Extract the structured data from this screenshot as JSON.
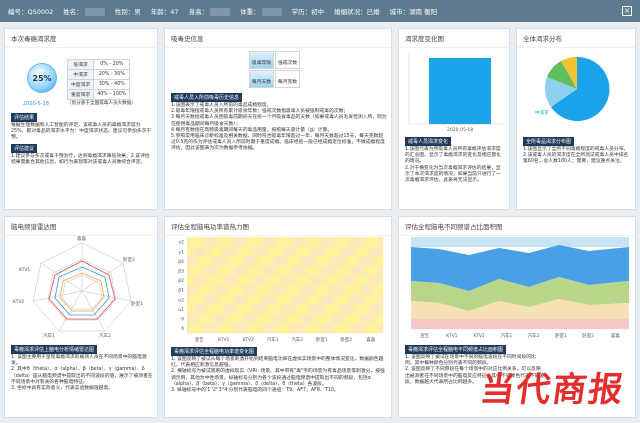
{
  "header": {
    "id_label": "编号：",
    "id_value": "QS0002",
    "name_label": "姓名：",
    "gender_label": "性别：",
    "gender_value": "男",
    "age_label": "年龄：",
    "age_value": "47",
    "height_label": "身高：",
    "weight_label": "体重：",
    "edu_label": "学历：",
    "edu_value": "初中",
    "marital_label": "婚姻状况：",
    "marital_value": "已婚",
    "city_label": "城市：",
    "city_value": "湖南 衡阳",
    "close_glyph": "×",
    "bar_color": "#5d7a8e"
  },
  "craving": {
    "title": "本次毒瘾渴求度",
    "percent": "25%",
    "date": "2020-5-18",
    "levels": [
      {
        "name": "低渴求",
        "range": "0% - 20%"
      },
      {
        "name": "中渴求",
        "range": "20% - 30%"
      },
      {
        "name": "中度渴求",
        "range": "30% - 40%"
      },
      {
        "name": "重度渴求",
        "range": "40% - 100%"
      }
    ],
    "footnote": "（划分基于全国戒毒人员大数据）",
    "result_tag": "评估结果",
    "result_text": "根据生理数据和人工智能的评定，该戒毒人员的毒瘾渴求度为25%，即对毒品的渴求水平为：中度渴求状态。建议可参加多次干预。",
    "advice_tag": "评估建议",
    "advice_text": "1.建议参与多次戒毒干预治疗，达到毒瘾渴求降低效果；2.该评估结果需集合其他信息，如行为表现等对该戒毒人员做综合评定。"
  },
  "history": {
    "title": "吸毒史信息",
    "cells": [
      "吸毒年限",
      "强戒次数",
      "每月天数",
      "每月克数"
    ],
    "tag": "戒毒人员入所前吸毒历史信息",
    "text": "1.该图表示了戒毒人员入所前的毒品成瘾程度。\n2.吸毒年限指戒毒人员所有累计吸食年数；强戒次数指吸毒人员被强制戒毒的次数；\n3.每月天数指戒毒人员回吸毒前期间天在统一个月吸食毒品的天数（如果戒毒人员毛发检测入所，则为在使用毒品期间每月吸食天数）；\n4.每月克数指在高频吸毒期间每天的毒品用量，按照每天吸计量（g）计算。\n5.参照常用临床诊断标准及相关数据，同时符合吸毒年限超过一年，每月天数超过15天，每天克数超过0.5克的作为评估戒毒人员入所前时期于重度成瘾。临床经验一般已经成瘾定位标准，不做成瘾程度评估，因此该图表为次为数据参考依据。"
  },
  "trend": {
    "title": "渴求度变化图",
    "date": "2020-05-18",
    "tag": "戒毒人员渴求变化",
    "text": "1.该图代表为所吸毒人员所有毒瘾评估渴求度的汇总图。显示了毒瘾渴求的变化及相应量化的情况。\n2.对于横变化为当次毒瘾渴求评估的结果，显示了本次渴求度的情况，如果当前只进行了一次毒瘾渴求评估，此表将无法显示。",
    "color": "#1aa3e8"
  },
  "distribution": {
    "title": "全体渴求分布",
    "tag": "全所毒品渴求分布图",
    "text": "1.该图显示了全所不同毒瘾程度的戒毒人员分布。\n2.该戒毒人员的渴求度在全所测试戒毒人员中排名第60名，总人数180人；需要，建议重点关注。",
    "slice_label": "中渴求",
    "colors": [
      "#1aa3e8",
      "#8fd0f0",
      "#5fbf5f",
      "#f2c230"
    ]
  },
  "radar": {
    "title": "脑电频谱雷达图",
    "labels": [
      "KTV1",
      "KTV2",
      "汽车1",
      "汽车2",
      "卧室1",
      "卧室2",
      "喜喜"
    ],
    "tag": "毒瘾渴求评估上脑电分析情绪雷达图",
    "text": "1. 该图主要用于呈现毒瘾渴求的被测人员在不同场景中的脑电激发。\n2. 其中θ（theta）、α（alpha）、β（beta）、γ（gamma）、δ（delta）是从脑电频谱中提取出的不同波段的值，展示了被测者在不同场景中对有关的各种脑电特征。\n3. 坐标中具有实际意义，代表实验数据值越高。"
  },
  "heatmap": {
    "title": "评估全程脑电功率谱热力图",
    "yticks": [
      "γ2",
      "γ1",
      "β4",
      "β3",
      "β2",
      "β1",
      "α2",
      "α1",
      "θ",
      "δ"
    ],
    "xticks": [
      "宣告",
      "KTV1",
      "KTV2",
      "汽车1",
      "汽车2",
      "卧室1",
      "卧室2",
      "喜喜"
    ],
    "tag": "毒瘾渴求评估全程脑电功率谱变化图",
    "text": "1. 该图反映了被试从每个场景刺激开始到结束脑电功率在虚拟实场景中的整体情况变化，数据颜色越红，代表相应刺激信息越强。\n2. 横轴标号为被试观看的虚拟现实（VR）场景。其中带有\"毒\"字的场景为有毒品场景等刺激分，按强调示例，其他为中性场景。纵轴标号分别为各个波段通过脑电频谱中提取出不同的频段，包括α（alpha）、β（beta）、γ（gamma）、δ（delta）、θ（theta）各波段。\n3. 纵轴标号中的'1''2''3''4'分别代表脑电的四个通道：T9、AF7、AF8、T10。"
  },
  "stacked": {
    "title": "评估全程脑电不同频谱占比面积图",
    "xticks": [
      "宣告",
      "KTV1",
      "KTV2",
      "汽车1",
      "汽车2",
      "卧室1",
      "卧室2",
      "喜喜"
    ],
    "tag": "毒瘾渴求评估全程脑电不同频谱占比面积图",
    "text": "1. 该图反映了被试在场景中不同的脑电波段在不同时间段的比例。其中每种颜色分别代表不同的频段。\n2. 该图反映了不同频段在每个场景中的对应比例关系，可以反映出被测者在不同场景中的脑电反应特征。其中不同颜色代表不同波段，数据越大代表所占比例越多。"
  },
  "watermark": "当代商报"
}
